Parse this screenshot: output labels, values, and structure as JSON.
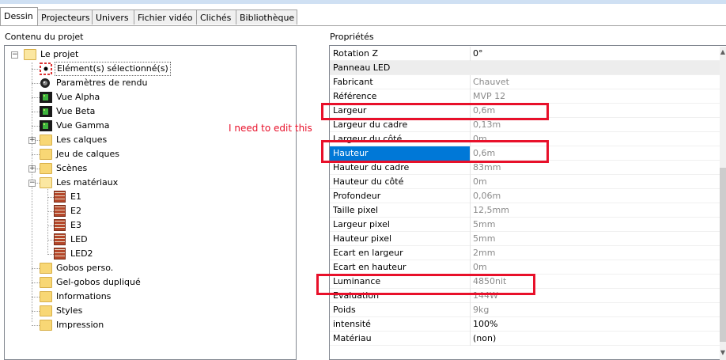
{
  "tabs": [
    {
      "label": "Dessin",
      "active": true
    },
    {
      "label": "Projecteurs"
    },
    {
      "label": "Univers"
    },
    {
      "label": "Fichier vidéo"
    },
    {
      "label": "Clichés"
    },
    {
      "label": "Bibliothèque"
    }
  ],
  "left_pane": {
    "title": "Contenu du projet",
    "tree": [
      {
        "label": "Le projet",
        "icon": "folder-open-icon",
        "expander": "−"
      },
      {
        "label": "Elément(s) sélectionné(s)",
        "icon": "target-icon",
        "selected": true
      },
      {
        "label": "Paramètres de rendu",
        "icon": "camera-lens-icon"
      },
      {
        "label": "Vue Alpha",
        "icon": "view-thumbnail-icon"
      },
      {
        "label": "Vue Beta",
        "icon": "view-thumbnail-icon"
      },
      {
        "label": "Vue Gamma",
        "icon": "view-thumbnail-icon"
      },
      {
        "label": "Les calques",
        "icon": "folder-icon",
        "expander": "+"
      },
      {
        "label": "Jeu de calques",
        "icon": "folder-icon"
      },
      {
        "label": "Scènes",
        "icon": "folder-icon",
        "expander": "+"
      },
      {
        "label": "Les matériaux",
        "icon": "folder-open-icon",
        "expander": "−"
      },
      {
        "label": "E1",
        "icon": "brick-icon"
      },
      {
        "label": "E2",
        "icon": "brick-icon"
      },
      {
        "label": "E3",
        "icon": "brick-icon"
      },
      {
        "label": "LED",
        "icon": "brick-icon"
      },
      {
        "label": "LED2",
        "icon": "brick-icon"
      },
      {
        "label": "Gobos perso.",
        "icon": "folder-icon"
      },
      {
        "label": "Gel-gobos dupliqué",
        "icon": "folder-icon"
      },
      {
        "label": "Informations",
        "icon": "folder-icon"
      },
      {
        "label": "Styles",
        "icon": "folder-icon"
      },
      {
        "label": "Impression",
        "icon": "folder-icon"
      }
    ]
  },
  "right_pane": {
    "title": "Propriétés",
    "rows": [
      {
        "name": "Rotation Z",
        "value": "0°"
      },
      {
        "name": "Panneau LED",
        "value": "",
        "category": true
      },
      {
        "name": "Fabricant",
        "value": "Chauvet",
        "gray": true
      },
      {
        "name": "Référence",
        "value": "MVP 12",
        "gray": true
      },
      {
        "name": "Largeur",
        "value": "0,6m",
        "gray": true
      },
      {
        "name": "Largeur du cadre",
        "value": "0,13m",
        "gray": true
      },
      {
        "name": "Largeur du côté",
        "value": "0m",
        "gray": true
      },
      {
        "name": "Hauteur",
        "value": "0,6m",
        "gray": true,
        "selected": true
      },
      {
        "name": "Hauteur du cadre",
        "value": "83mm",
        "gray": true
      },
      {
        "name": "Hauteur du côté",
        "value": "0m",
        "gray": true
      },
      {
        "name": "Profondeur",
        "value": "0,06m",
        "gray": true
      },
      {
        "name": "Taille pixel",
        "value": "12,5mm",
        "gray": true
      },
      {
        "name": "Largeur pixel",
        "value": "5mm",
        "gray": true
      },
      {
        "name": "Hauteur pixel",
        "value": "5mm",
        "gray": true
      },
      {
        "name": "Ecart en largeur",
        "value": "2mm",
        "gray": true
      },
      {
        "name": "Ecart en hauteur",
        "value": "0m",
        "gray": true
      },
      {
        "name": "Luminance",
        "value": "4850nit",
        "gray": true
      },
      {
        "name": "Evaluation",
        "value": "144W",
        "gray": true
      },
      {
        "name": "Poids",
        "value": "9kg",
        "gray": true
      },
      {
        "name": "intensité",
        "value": "100%"
      },
      {
        "name": "Matériau",
        "value": "(non)"
      }
    ]
  },
  "annotation": {
    "text": "I need to edit this",
    "color": "#e8102a"
  },
  "colors": {
    "accent": "#0078d7",
    "highlight": "#e8102a"
  }
}
